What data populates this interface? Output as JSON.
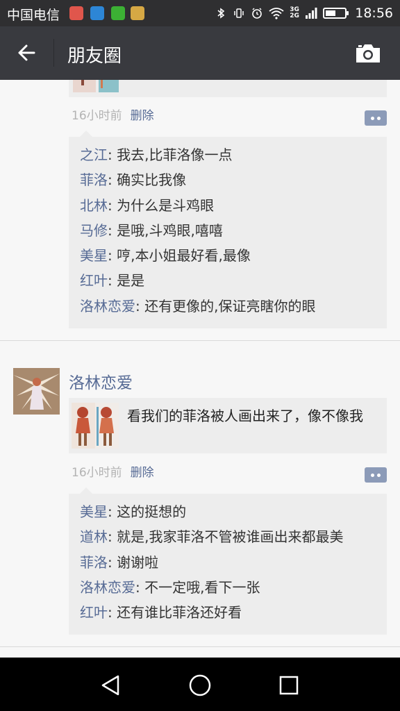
{
  "status_bar": {
    "carrier": "中国电信",
    "network_label": "3G 2G",
    "battery_level": 0.55,
    "time": "18:56",
    "icons": [
      "app-icon-red",
      "app-icon-blue",
      "app-icon-green",
      "app-icon-yellow",
      "bluetooth-icon",
      "vibrate-icon",
      "alarm-icon",
      "wifi-icon",
      "signal-icon",
      "battery-icon"
    ]
  },
  "header": {
    "title": "朋友圈",
    "back_icon": "back-arrow-icon",
    "camera_icon": "camera-icon"
  },
  "posts": [
    {
      "time": "16小时前",
      "delete_label": "删除",
      "comments": [
        {
          "name": "之江",
          "sep": ": ",
          "text": "我去,比菲洛像一点"
        },
        {
          "name": "菲洛",
          "sep": ": ",
          "text": "确实比我像"
        },
        {
          "name": "北林",
          "sep": ": ",
          "text": "为什么是斗鸡眼"
        },
        {
          "name": "马修",
          "sep": ": ",
          "text": "是哦,斗鸡眼,嘻嘻"
        },
        {
          "name": "美星",
          "sep": ": ",
          "text": "哼,本小姐最好看,最像"
        },
        {
          "name": "红叶",
          "sep": ": ",
          "text": "是是"
        },
        {
          "name": "洛林恋爱",
          "sep": ": ",
          "text": "还有更像的,保证亮瞎你的眼"
        }
      ]
    },
    {
      "author": "洛林恋爱",
      "share_text": "看我们的菲洛被人画出来了，像不像我",
      "time": "16小时前",
      "delete_label": "删除",
      "comments": [
        {
          "name": "美星",
          "sep": ": ",
          "text": "这的挺想的"
        },
        {
          "name": "道林",
          "sep": ": ",
          "text": "就是,我家菲洛不管被谁画出来都最美"
        },
        {
          "name": "菲洛",
          "sep": ": ",
          "text": "谢谢啦"
        },
        {
          "name": "洛林恋爱",
          "sep": ": ",
          "text": "不一定哦,看下一张"
        },
        {
          "name": "红叶",
          "sep": ": ",
          "text": "还有谁比菲洛还好看"
        }
      ]
    }
  ],
  "nav_bar": {
    "icons": [
      "back-triangle-icon",
      "home-circle-icon",
      "recents-square-icon"
    ]
  },
  "colors": {
    "link_blue": "#576b95",
    "title_bar": "#393a3f",
    "status_bar": "#2f2f31",
    "comment_bg": "#ededed"
  }
}
